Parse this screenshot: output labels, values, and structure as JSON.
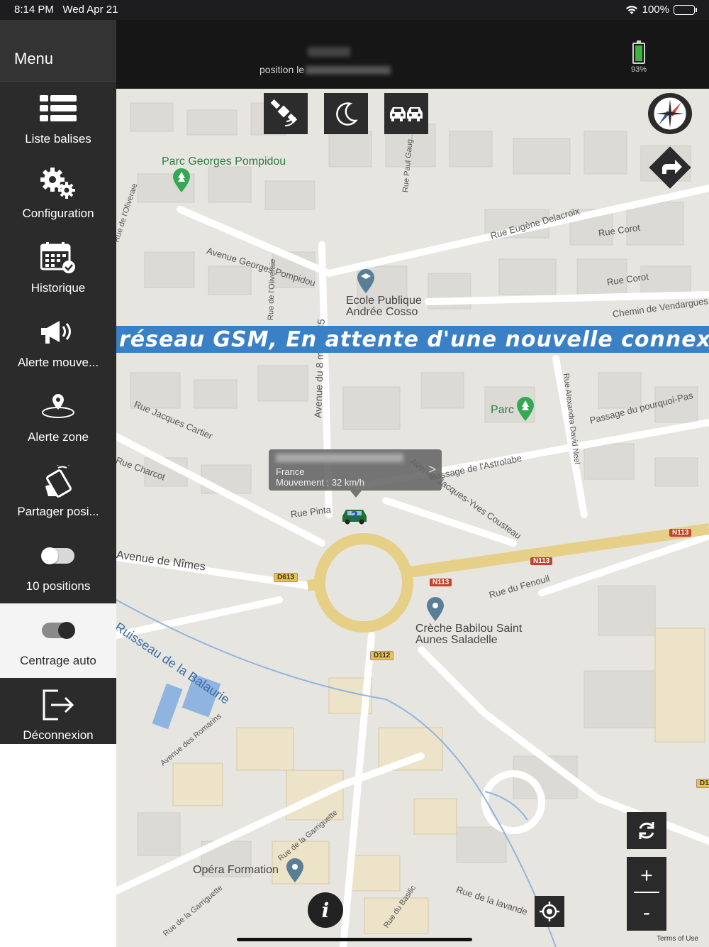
{
  "status_bar": {
    "time": "8:14 PM",
    "date": "Wed Apr 21",
    "battery": "100%",
    "wifi_icon": "wifi-icon"
  },
  "sidebar": {
    "title": "Menu",
    "items": [
      {
        "label": "Liste balises",
        "icon": "list-icon"
      },
      {
        "label": "Configuration",
        "icon": "gears-icon"
      },
      {
        "label": "Historique",
        "icon": "calendar-icon"
      },
      {
        "label": "Alerte mouve...",
        "icon": "megaphone-icon"
      },
      {
        "label": "Alerte zone",
        "icon": "zone-pin-icon"
      },
      {
        "label": "Partager posi...",
        "icon": "share-phone-icon"
      },
      {
        "label": "10 positions",
        "icon": "toggle-off",
        "toggle": false
      },
      {
        "label": "Centrage auto",
        "icon": "toggle-on",
        "toggle": true
      },
      {
        "label": "Déconnexion",
        "icon": "logout-icon"
      }
    ]
  },
  "header": {
    "position_prefix": "position le",
    "battery_percent": "93%"
  },
  "map": {
    "banner": "réseau GSM, En attente d'une nouvelle connexion",
    "popup": {
      "country": "France",
      "movement": "Mouvement : 32 km/h",
      "chevron": ">"
    },
    "labels": {
      "parc_pompidou": "Parc Georges Pompidou",
      "avenue_pompidou": "Avenue Georges Pompidou",
      "rue_oliveraie": "Rue de l'Oliveraie",
      "rue_oliveraie2": "Rue de l'Oliveraie",
      "rue_paul_gauguin": "Rue Paul Gaug...",
      "rue_delacroix": "Rue Eugène Delacroix",
      "rue_corot": "Rue Corot",
      "rue_corot2": "Rue Corot",
      "ecole": "Ecole Publique",
      "ecole2": "Andrée Cosso",
      "chemin_vendargues": "Chemin de Vendargues",
      "avenue_8mai": "Avenue du 8 mai 1945",
      "rue_jacques_cartier": "Rue Jacques Cartier",
      "parc": "Parc",
      "rue_alexandra": "Rue Alexandra David Neel",
      "passage_pourquoi": "Passage du pourquoi-Pas",
      "rue_charcot": "Rue Charcot",
      "passage_astrolabe": "Passage de l'Astrolabe",
      "avenue_cousteau": "Avenue Jacques-Yves Cousteau",
      "rue_pinta": "Rue Pinta",
      "avenue_nimes": "Avenue de Nîmes",
      "rue_fenouil": "Rue du Fenouil",
      "creche": "Crèche Babilou Saint",
      "creche2": "Aunes Saladelle",
      "ruisseau": "Ruisseau de la Balaurie",
      "avenue_romarins": "Avenue des Romarins",
      "opera": "Opéra Formation",
      "rue_garriguette": "Rue de la Garriguette",
      "rue_garriguette2": "Rue de la Garriguette",
      "rue_basilic": "Rue du Basilic",
      "rue_lavande": "Rue de la lavande",
      "n113_a": "N113",
      "n113_b": "N113",
      "n113_c": "N113",
      "d613": "D613",
      "d112": "D112",
      "d1": "D1"
    },
    "zoom_in": "+",
    "zoom_out": "-",
    "info": "i",
    "terms": "Terms of Use"
  },
  "colors": {
    "sidebar_bg": "#2b2b2b",
    "banner_bg": "#3a80c6",
    "active_bg": "#f4f4f4"
  }
}
